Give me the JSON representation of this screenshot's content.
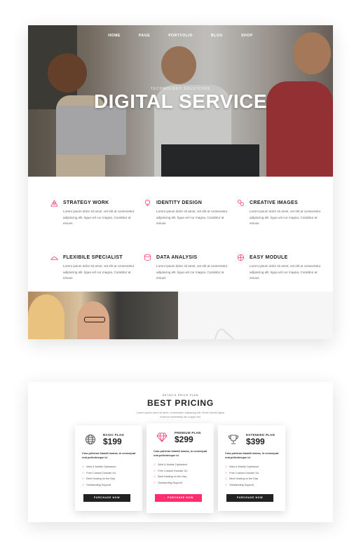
{
  "nav": [
    "HOME",
    "PAGE",
    "PORTFOLIO",
    "BLOG",
    "SHOP"
  ],
  "hero": {
    "subtitle": "TECHNOLOGY SOLUTIONS",
    "title": "DIGITAL SERVICE"
  },
  "features": [
    {
      "title": "STRATEGY WORK",
      "icon": "strategy-icon",
      "text": "Lorem ipsum dolor sit amet, vet elit at consectetur adipiscing elit. ligua vel cur magna, Curabitur at eniuus"
    },
    {
      "title": "IDENTITY DESIGN",
      "icon": "lightbulb-icon",
      "text": "Lorem ipsum dolor sit amet, vet elit at consectetur adipiscing elit. ligua vel cur magna, Curabitur at eniuus"
    },
    {
      "title": "CREATIVE IMAGES",
      "icon": "creative-icon",
      "text": "Lorem ipsum dolor sit amet, vet elit at consectetur adipiscing elit. ligua vel cur magna, Curabitur at eniuus"
    },
    {
      "title": "FLEXIBILE SPECIALIST",
      "icon": "specialist-icon",
      "text": "Lorem ipsum dolor sit amet, vet elit at consectetur adipiscing elit. ligua vel cur magna, Curabitur at eniuus"
    },
    {
      "title": "DATA ANALYSIS",
      "icon": "data-icon",
      "text": "Lorem ipsum dolor sit amet, vet elit at consectetur adipiscing elit. ligua vel cur magna, Curabitur at eniuus"
    },
    {
      "title": "EASY MODULE",
      "icon": "module-icon",
      "text": "Lorem ipsum dolor sit amet, vet elit at consectetur adipiscing elit. ligua vel cur magna, Curabitur at eniuus"
    }
  ],
  "pricing": {
    "subtitle": "DETAILS PRICE PLAN",
    "title": "BEST PRICING",
    "description": "Lorem ipsum dolor sit amet, consectetur adipiscing elit. Morbi obortis ligula euismod sededasty am augue nisl.",
    "plans": [
      {
        "name": "BASIC PLAN",
        "price": "$199",
        "icon": "globe-icon",
        "description": "Cras pulvinar blandit massa, in consequat erat pellentesque id.",
        "features": [
          "Web & Mobile Optimized",
          "Free Custom Domain Go",
          "Best Hosting on the Day",
          "Outstanding Support"
        ],
        "button": "PURCHASE NOW"
      },
      {
        "name": "PREMIUM PLAN",
        "price": "$299",
        "icon": "diamond-icon",
        "description": "Cras pulvinar blandit massa, in consequat erat pellentesque id.",
        "features": [
          "Web & Mobile Optimized",
          "Free Custom Domain Go",
          "Best Hosting on the Day",
          "Outstanding Support"
        ],
        "button": "PURCHASE NOW"
      },
      {
        "name": "EXTENDED PLAN",
        "price": "$399",
        "icon": "trophy-icon",
        "description": "Cras pulvinar blandit massa, in consequat erat pellentesque id.",
        "features": [
          "Web & Mobile Optimized",
          "Free Custom Domain Go",
          "Best Hosting on the Day",
          "Outstanding Support"
        ],
        "button": "PURCHASE NOW"
      }
    ]
  },
  "colors": {
    "accent": "#ff2d6d",
    "dark": "#222222"
  }
}
